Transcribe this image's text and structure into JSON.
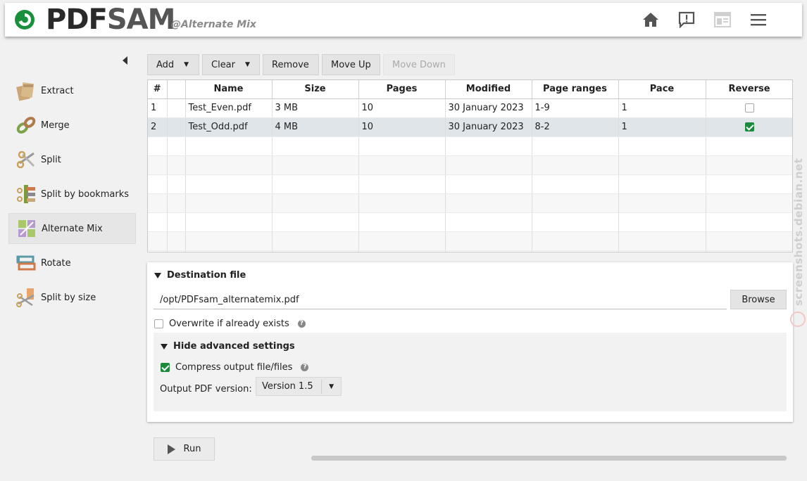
{
  "header": {
    "logo_pdf": "PDF",
    "logo_sam": "SAM",
    "module_tag": "@Alternate Mix",
    "buttons": [
      "home-icon",
      "feedback-icon",
      "news-icon",
      "menu-icon"
    ]
  },
  "sidebar": {
    "items": [
      {
        "label": "Extract",
        "icon": "extract-icon",
        "active": false
      },
      {
        "label": "Merge",
        "icon": "merge-icon",
        "active": false
      },
      {
        "label": "Split",
        "icon": "split-icon",
        "active": false
      },
      {
        "label": "Split by bookmarks",
        "icon": "split-bookmarks-icon",
        "active": false
      },
      {
        "label": "Alternate Mix",
        "icon": "alternate-mix-icon",
        "active": true
      },
      {
        "label": "Rotate",
        "icon": "rotate-icon",
        "active": false
      },
      {
        "label": "Split by size",
        "icon": "split-size-icon",
        "active": false
      }
    ]
  },
  "toolbar": {
    "add": "Add",
    "clear": "Clear",
    "remove": "Remove",
    "move_up": "Move Up",
    "move_down": "Move Down"
  },
  "table": {
    "headers": [
      "#",
      "",
      "Name",
      "Size",
      "Pages",
      "Modified",
      "Page ranges",
      "Pace",
      "Reverse"
    ],
    "rows": [
      {
        "num": "1",
        "name": "Test_Even.pdf",
        "size": "3 MB",
        "pages": "10",
        "modified": "30 January 2023",
        "ranges": "1-9",
        "pace": "1",
        "reverse": false
      },
      {
        "num": "2",
        "name": "Test_Odd.pdf",
        "size": "4 MB",
        "pages": "10",
        "modified": "30 January 2023",
        "ranges": "8-2",
        "pace": "1",
        "reverse": true
      }
    ],
    "selected_row": 1
  },
  "destination": {
    "title": "Destination file",
    "path": "/opt/PDFsam_alternatemix.pdf",
    "browse": "Browse",
    "overwrite_label": "Overwrite if already exists",
    "overwrite_checked": false,
    "advanced_title": "Hide advanced settings",
    "compress_label": "Compress output file/files",
    "compress_checked": true,
    "version_label": "Output PDF version:",
    "version_value": "Version 1.5"
  },
  "run": {
    "label": "Run"
  },
  "watermark": "screenshots.debian.net",
  "colors": {
    "accent_green": "#1c8a3a",
    "selected_row": "#e0e5ea"
  }
}
